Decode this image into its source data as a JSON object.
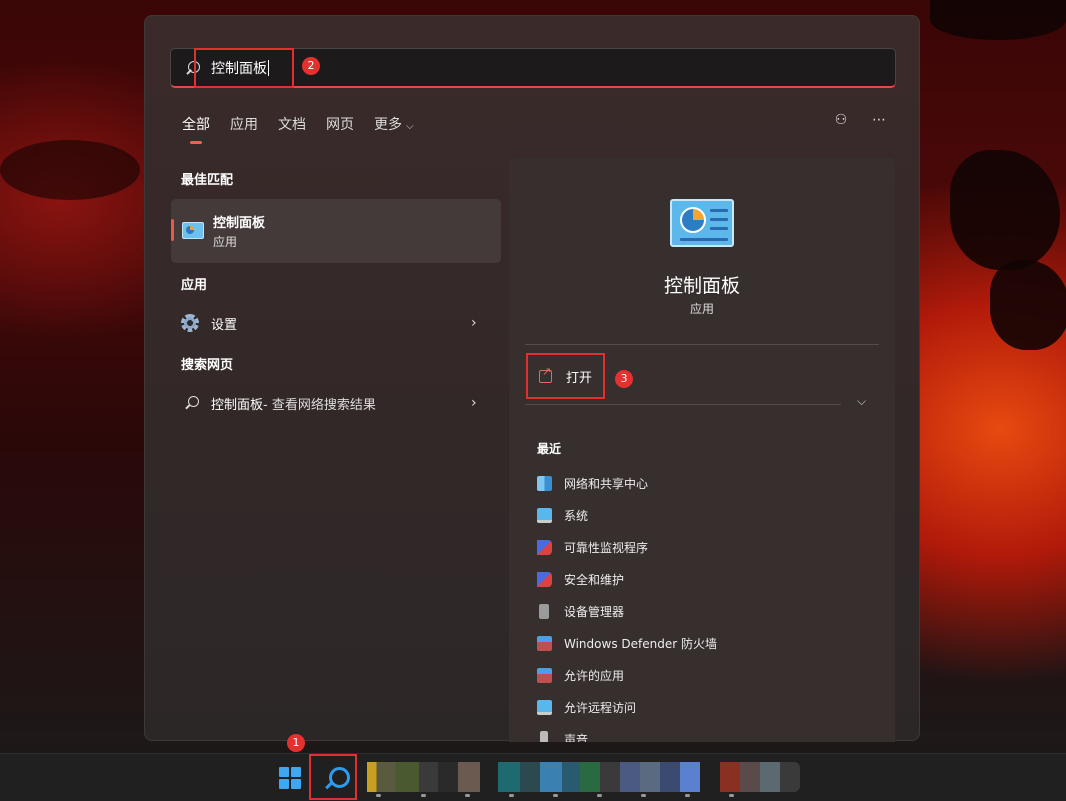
{
  "search": {
    "query": "控制面板"
  },
  "badges": {
    "one": "1",
    "two": "2",
    "three": "3"
  },
  "tabs": [
    {
      "label": "全部"
    },
    {
      "label": "应用"
    },
    {
      "label": "文档"
    },
    {
      "label": "网页"
    },
    {
      "label": "更多"
    }
  ],
  "left": {
    "best_match_title": "最佳匹配",
    "best_match": {
      "name": "控制面板",
      "type": "应用"
    },
    "apps_title": "应用",
    "apps": [
      {
        "label": "设置"
      }
    ],
    "web_title": "搜索网页",
    "web_result": {
      "query": "控制面板",
      "suffix": " - 查看网络搜索结果"
    }
  },
  "detail": {
    "name": "控制面板",
    "type": "应用",
    "open_label": "打开",
    "recent_title": "最近",
    "recent": [
      {
        "label": "网络和共享中心",
        "icon": "network-icon"
      },
      {
        "label": "系统",
        "icon": "monitor-icon"
      },
      {
        "label": "可靠性监视程序",
        "icon": "flag-icon"
      },
      {
        "label": "安全和维护",
        "icon": "flag-icon"
      },
      {
        "label": "设备管理器",
        "icon": "device-manager-icon"
      },
      {
        "label": "Windows Defender 防火墙",
        "icon": "firewall-icon"
      },
      {
        "label": "允许的应用",
        "icon": "firewall-icon"
      },
      {
        "label": "允许远程访问",
        "icon": "monitor-icon"
      },
      {
        "label": "声音",
        "icon": "speaker-icon"
      }
    ]
  },
  "colors": {
    "accent": "#e24a3c",
    "highlight": "#e03030",
    "taskbar_blue": "#2d9cf0"
  }
}
